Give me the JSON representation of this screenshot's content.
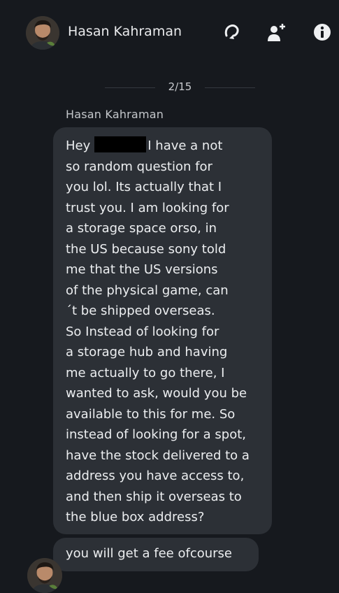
{
  "header": {
    "contact_name": "Hasan Kahraman",
    "icons": [
      "call-icon",
      "add-person-icon",
      "info-icon"
    ]
  },
  "thread": {
    "counter": "2/15",
    "sender_name": "Hasan Kahraman",
    "message_lines": [
      "Hey",
      "I have a not",
      "so random question for",
      "you lol. Its actually that I",
      "trust you. I am looking for",
      "a storage space orso, in",
      "the US because sony told",
      "me that the US versions",
      "of the physical game, can",
      "´t be shipped overseas.",
      "So Instead of looking for",
      "a storage hub and having",
      "me actually to go there, I",
      "wanted to ask, would you be",
      "available to this for me. So",
      "instead of looking for a spot,",
      "have the stock delivered to a",
      "address you have access to,",
      "and then ship it overseas to",
      "the blue box address?"
    ],
    "second_message": "you will get a fee ofcourse"
  },
  "colors": {
    "background": "#16191e",
    "bubble": "#2c3036",
    "text": "#eceef0",
    "redaction": "#000000"
  }
}
